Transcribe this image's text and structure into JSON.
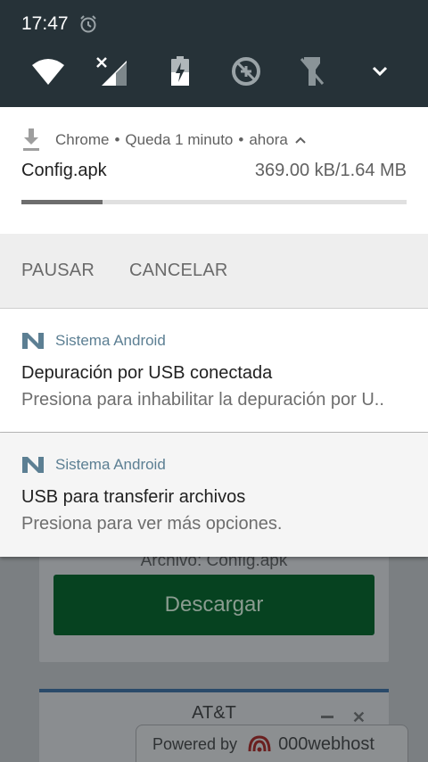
{
  "status_bar": {
    "time": "17:47",
    "icons": [
      "alarm-icon"
    ]
  },
  "quick_settings": {
    "tiles": [
      "wifi-icon",
      "cellular-no-data-icon",
      "battery-charging-icon",
      "data-saver-off-icon",
      "flashlight-off-icon",
      "expand-chevron-icon"
    ]
  },
  "download_notification": {
    "app": "Chrome",
    "remaining": "Queda 1 minuto",
    "time": "ahora",
    "file_name": "Config.apk",
    "size_progress": "369.00 kB/1.64 MB",
    "progress_fraction": 0.21,
    "actions": {
      "pause": "PAUSAR",
      "cancel": "CANCELAR"
    }
  },
  "notifications": [
    {
      "app": "Sistema Android",
      "title": "Depuración por USB conectada",
      "text": "Presiona para inhabilitar la depuración por U.."
    },
    {
      "app": "Sistema Android",
      "title": "USB para transferir archivos",
      "text": "Presiona para ver más opciones."
    }
  ],
  "background_page": {
    "file_label": "Archivo: Config.apk",
    "download_button": "Descargar",
    "carrier_banner": "AT&T",
    "powered_by": "Powered by",
    "host_brand": "000webhost"
  },
  "colors": {
    "status_bar": "#263238",
    "android_accent": "#5c7f93",
    "download_button": "#064220"
  }
}
